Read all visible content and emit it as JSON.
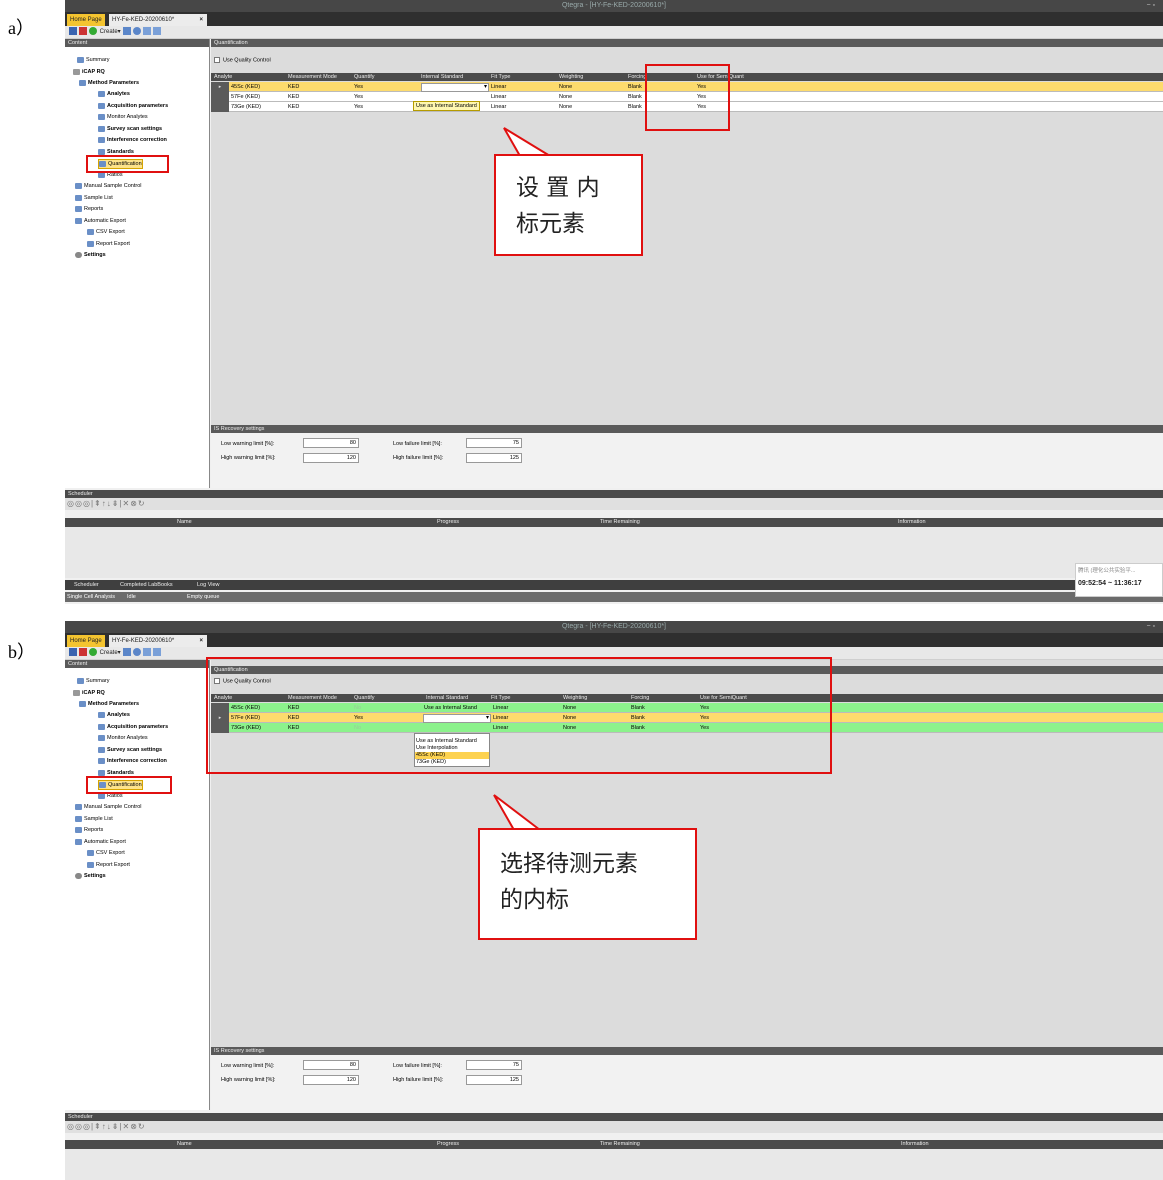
{
  "labels": {
    "a": "a）",
    "b": "b）"
  },
  "app": {
    "window_title": "Qtegra - [HY-Fe-KED-20200610*]",
    "home_tab": "Home Page",
    "doc_tab": "HY-Fe-KED-20200610*",
    "doc_tab_close": "×",
    "toolbar_create": "Create▾",
    "window_controls": "− ▫"
  },
  "sidebar": {
    "header": "Content",
    "items": [
      {
        "label": "Summary"
      },
      {
        "label": "iCAP RQ"
      },
      {
        "label": "Method Parameters"
      },
      {
        "label": "Analytes"
      },
      {
        "label": "Acquisition parameters"
      },
      {
        "label": "Monitor Analytes"
      },
      {
        "label": "Survey scan settings"
      },
      {
        "label": "Interference correction"
      },
      {
        "label": "Standards"
      },
      {
        "label": "Quantification"
      },
      {
        "label": "Ratios"
      },
      {
        "label": "Manual Sample Control"
      },
      {
        "label": "Sample List"
      },
      {
        "label": "Reports"
      },
      {
        "label": "Automatic Export"
      },
      {
        "label": "CSV Export"
      },
      {
        "label": "Report Export"
      },
      {
        "label": "Settings"
      }
    ]
  },
  "quantification": {
    "header": "Quantification",
    "use_quality_control": "Use Quality Control",
    "columns": [
      "Analyte",
      "Measurement Mode",
      "Quantify",
      "Internal Standard",
      "Fit Type",
      "Weighting",
      "Forcing",
      "Use for SemiQuant"
    ]
  },
  "panel_a": {
    "rows": [
      {
        "analyte": "45Sc (KED)",
        "mode": "KED",
        "quantify": "Yes",
        "internal_standard": "",
        "fit": "Linear",
        "weighting": "None",
        "forcing": "Blank",
        "semiquant": "Yes"
      },
      {
        "analyte": "57Fe (KED)",
        "mode": "KED",
        "quantify": "Yes",
        "internal_standard": "",
        "fit": "Linear",
        "weighting": "None",
        "forcing": "Blank",
        "semiquant": "Yes"
      },
      {
        "analyte": "73Ge (KED)",
        "mode": "KED",
        "quantify": "Yes",
        "internal_standard": "",
        "fit": "Linear",
        "weighting": "None",
        "forcing": "Blank",
        "semiquant": "Yes"
      }
    ],
    "tooltip": "Use as Internal Standard",
    "callout_line1": "设 置 内",
    "callout_line2": "标元素"
  },
  "panel_b": {
    "rows": [
      {
        "analyte": "45Sc (KED)",
        "mode": "KED",
        "quantify": "No",
        "internal_standard": "Use as Internal Stand",
        "fit": "Linear",
        "weighting": "None",
        "forcing": "Blank",
        "semiquant": "Yes"
      },
      {
        "analyte": "57Fe (KED)",
        "mode": "KED",
        "quantify": "Yes",
        "internal_standard": "",
        "fit": "Linear",
        "weighting": "None",
        "forcing": "Blank",
        "semiquant": "Yes"
      },
      {
        "analyte": "73Ge (KED)",
        "mode": "KED",
        "quantify": "No",
        "internal_standard": "",
        "fit": "Linear",
        "weighting": "None",
        "forcing": "Blank",
        "semiquant": "Yes"
      }
    ],
    "dropdown_options": [
      "Use as Internal Standard",
      "Use Interpolation",
      "45Sc (KED)",
      "73Ge (KED)"
    ],
    "dropdown_selected": "45Sc (KED)",
    "callout_line1": "选择待测元素",
    "callout_line2": "的内标"
  },
  "is_recovery": {
    "header": "IS Recovery settings",
    "low_warning_label": "Low warning limit [%]:",
    "low_warning_value": "80",
    "high_warning_label": "High warning limit [%]:",
    "high_warning_value": "120",
    "low_failure_label": "Low failure limit [%]:",
    "low_failure_value": "75",
    "high_failure_label": "High failure limit [%]:",
    "high_failure_value": "125"
  },
  "scheduler": {
    "header": "Scheduler",
    "toolbar_glyphs": "◎◎◎|⇞↑↓⇟|✕⊗↻",
    "columns": [
      "Name",
      "Progress",
      "Time Remaining",
      "Information"
    ],
    "bottom_tabs": [
      "Scheduler",
      "Completed LabBooks",
      "Log View"
    ],
    "status": [
      "Single Cell Analysis",
      "Idle",
      "Empty queue"
    ]
  },
  "clock": {
    "app_name": "腾讯 (理化公共实验平...",
    "time_range": "09:52:54 ~ 11:36:17"
  },
  "colors": {
    "highlight_row": "#fddb6d",
    "green_row": "#8cf28c",
    "annotation_red": "#e01010"
  }
}
